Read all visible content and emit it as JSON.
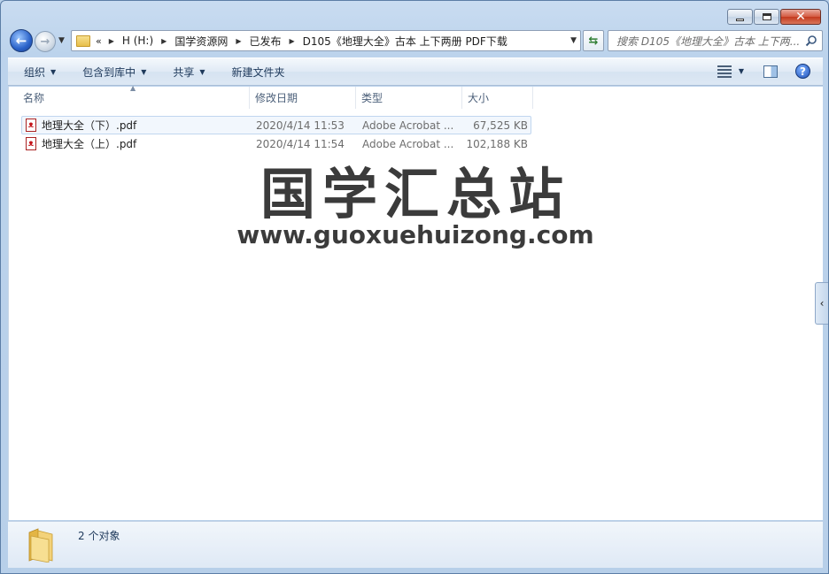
{
  "window": {
    "caption": {
      "minimize": "min",
      "maximize": "max",
      "close": "close"
    }
  },
  "nav": {
    "chevrons": "«",
    "breadcrumbs": [
      "H (H:)",
      "国学资源网",
      "已发布",
      "D105《地理大全》古本 上下两册 PDF下载"
    ],
    "search_placeholder": "搜索 D105《地理大全》古本 上下两..."
  },
  "toolbar": {
    "organize": "组织",
    "include_in_library": "包含到库中",
    "share": "共享",
    "new_folder": "新建文件夹"
  },
  "columns": {
    "name": "名称",
    "date": "修改日期",
    "type": "类型",
    "size": "大小"
  },
  "files": [
    {
      "name": "地理大全（下）.pdf",
      "date": "2020/4/14 11:53",
      "type": "Adobe Acrobat ...",
      "size": "67,525 KB"
    },
    {
      "name": "地理大全（上）.pdf",
      "date": "2020/4/14 11:54",
      "type": "Adobe Acrobat ...",
      "size": "102,188 KB"
    }
  ],
  "watermark": {
    "title": "国学汇总站",
    "url": "www.guoxuehuizong.com"
  },
  "details": {
    "count": "2 个对象"
  },
  "colors": {
    "accent": "#1e395b",
    "chrome": "#b9d1ea",
    "close_red": "#c33a1e",
    "pdf_red": "#c4161c"
  }
}
